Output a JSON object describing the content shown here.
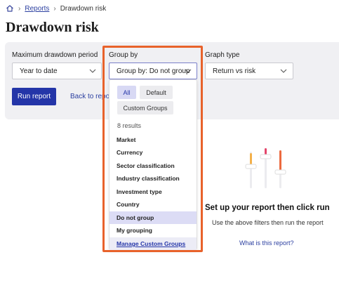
{
  "breadcrumb": {
    "icon": "home-icon",
    "reports_link": "Reports",
    "current": "Drawdown risk"
  },
  "page": {
    "title": "Drawdown risk"
  },
  "filters": {
    "max_drawdown": {
      "label": "Maximum drawdown period",
      "value": "Year to date"
    },
    "group_by": {
      "label": "Group by",
      "value": "Group by: Do not group"
    },
    "graph_type": {
      "label": "Graph type",
      "value": "Return vs risk"
    }
  },
  "actions": {
    "run_label": "Run report",
    "back_label": "Back to repor"
  },
  "dropdown": {
    "chips": [
      {
        "label": "All",
        "active": true
      },
      {
        "label": "Default",
        "active": false
      },
      {
        "label": "Custom Groups",
        "active": false
      }
    ],
    "results_text": "8 results",
    "options": [
      {
        "label": "Market"
      },
      {
        "label": "Currency"
      },
      {
        "label": "Sector classification"
      },
      {
        "label": "Industry classification"
      },
      {
        "label": "Investment type"
      },
      {
        "label": "Country"
      },
      {
        "label": "Do not group",
        "selected": true
      },
      {
        "label": "My grouping"
      }
    ],
    "manage_label": "Manage Custom Groups"
  },
  "empty_state": {
    "icon": "sliders-icon",
    "title": "Set up your report then click run",
    "subtitle": "Use the above filters then run the report",
    "link": "What is this report?"
  },
  "colors": {
    "primary": "#2435a8",
    "link": "#2b3fa0",
    "highlight": "#e8622b",
    "panel_bg": "#f0f0f3",
    "selected_option": "#dcdcf5"
  }
}
